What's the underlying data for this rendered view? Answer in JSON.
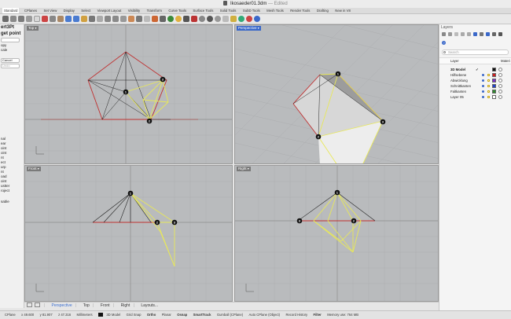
{
  "window": {
    "title": "Ikosaeder01.3dm",
    "status": "— Edited"
  },
  "tabs": [
    "Standard",
    "CPlanes",
    "Set View",
    "Display",
    "Select",
    "Viewport Layout",
    "Visibility",
    "Transform",
    "Curve Tools",
    "Surface Tools",
    "Solid Tools",
    "SubD Tools",
    "Mesh Tools",
    "Render Tools",
    "Drafting",
    "New in V8"
  ],
  "active_tab": "Standard",
  "command_panel": {
    "lines": [
      "ert3Pt",
      "get point",
      "",
      "opy",
      "cale",
      "",
      "Cancel",
      "Undo"
    ],
    "list": [
      "nal",
      "ear",
      "oint",
      "oint",
      "nt",
      "ect",
      "urp",
      "nt",
      "oad",
      "oint",
      "ustter",
      "roject",
      "",
      "sable"
    ]
  },
  "viewports": {
    "top": {
      "label": "Top"
    },
    "perspective": {
      "label": "Perspective"
    },
    "front": {
      "label": "Front"
    },
    "right": {
      "label": "Right"
    }
  },
  "viewport_tabs": {
    "items": [
      "Perspective",
      "Top",
      "Front",
      "Right",
      "Layouts..."
    ],
    "active": "Perspective"
  },
  "status_bar": {
    "cplane": "CPlane",
    "x": "x 49.600",
    "y": "y 81.907",
    "z": "z 47.316",
    "units": "Millimeters",
    "layer": "3D Model",
    "grid_snap": "Grid Snap",
    "ortho": "Ortho",
    "planar": "Planar",
    "osnap": "Osnap",
    "smarttrack": "SmartTrack",
    "gumball": "Gumball (CPlane)",
    "auto_cplane": "Auto CPlane (Object)",
    "record_history": "Record History",
    "filter": "Filter",
    "memory": "Memory use: 764 MB"
  },
  "layers_panel": {
    "title": "Layers",
    "search_placeholder": "Search",
    "columns": {
      "layer": "Layer",
      "material": "Materi"
    },
    "rows": [
      {
        "name": "3D Model",
        "current": true,
        "color": "#111111"
      },
      {
        "name": "Hilfsebene",
        "current": false,
        "color": "#cc1f1f"
      },
      {
        "name": "Abwicklung",
        "current": false,
        "color": "#7a2ccc"
      },
      {
        "name": "Schnittkanten",
        "current": false,
        "color": "#2140cc"
      },
      {
        "name": "Faltkanten",
        "current": false,
        "color": "#2e8b2e"
      },
      {
        "name": "Layer 05",
        "current": false,
        "color": "#ffffff"
      }
    ]
  },
  "points": {
    "p1": "1",
    "p2": "2",
    "p3": "3"
  },
  "colors": {
    "accent": "#3a68c9",
    "viewport_bg": "#b9bbbd",
    "edge_red": "#c03030",
    "edge_yellow": "#e8e85a",
    "edge_black": "#111111"
  }
}
